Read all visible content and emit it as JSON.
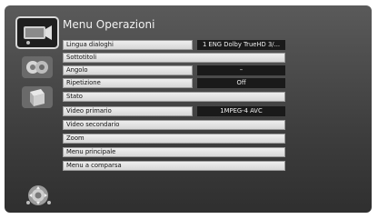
{
  "menu": {
    "title": "Menu Operazioni",
    "tabs": [
      {
        "icon": "video-player-icon",
        "active": true
      },
      {
        "icon": "audio-icon",
        "active": false
      },
      {
        "icon": "display-icon",
        "active": false
      }
    ],
    "items": [
      {
        "label": "Lingua dialoghi",
        "value": "1 ENG Dolby TrueHD  3/..."
      },
      {
        "label": "Sottotitoli",
        "value": null
      },
      {
        "label": "Angolo",
        "value": "–"
      },
      {
        "label": "Ripetizione",
        "value": "Off"
      },
      {
        "label": "Stato",
        "value": null
      },
      {
        "label": "Video primario",
        "value": "1MPEG-4 AVC"
      },
      {
        "label": "Video secondario",
        "value": null
      },
      {
        "label": "Zoom",
        "value": null
      },
      {
        "label": "Menu principale",
        "value": null
      },
      {
        "label": "Menu a comparsa",
        "value": null
      }
    ],
    "navigation_icon": "directional-pad-icon"
  }
}
